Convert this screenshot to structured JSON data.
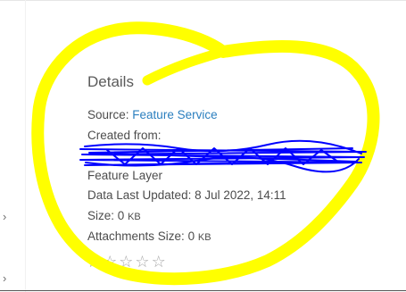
{
  "details": {
    "title": "Details",
    "source_label": "Source:",
    "source_link": "Feature Service",
    "created_from_label": "Created from:",
    "item_type": "Feature Layer",
    "data_last_updated_label": "Data Last Updated:",
    "data_last_updated_value": "8 Jul 2022, 14:11",
    "size_label": "Size:",
    "size_value": "0",
    "size_unit": "KB",
    "attachments_size_label": "Attachments Size:",
    "attachments_size_value": "0",
    "attachments_size_unit": "KB"
  },
  "rating": {
    "max": 5,
    "value": 0,
    "star_icon": "☆"
  },
  "side": {
    "expand_icon": "›"
  },
  "colors": {
    "highlight": "#ffff00",
    "redaction": "#0000ff",
    "link": "#2b7fbf"
  }
}
